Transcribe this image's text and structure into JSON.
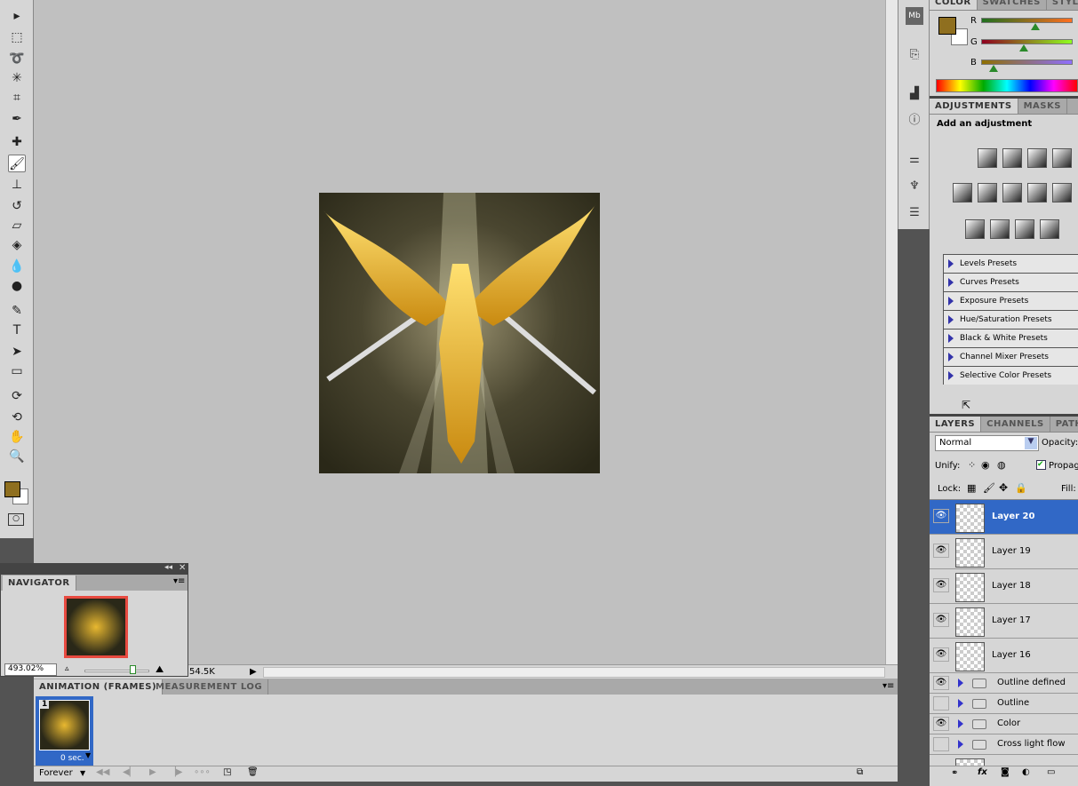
{
  "tools": [
    {
      "icon": "move-icon",
      "g": "▸"
    },
    {
      "icon": "marquee-icon",
      "g": "⬚"
    },
    {
      "icon": "lasso-icon",
      "g": "➰"
    },
    {
      "icon": "magic-wand-icon",
      "g": "✳"
    },
    {
      "icon": "crop-icon",
      "g": "⌗"
    },
    {
      "icon": "eyedropper-icon",
      "g": "✒"
    },
    {
      "icon": "healing-brush-icon",
      "g": "✚"
    },
    {
      "icon": "brush-icon",
      "g": "🖌"
    },
    {
      "icon": "clone-stamp-icon",
      "g": "⊥"
    },
    {
      "icon": "history-brush-icon",
      "g": "↺"
    },
    {
      "icon": "eraser-icon",
      "g": "▱"
    },
    {
      "icon": "paint-bucket-icon",
      "g": "◈"
    },
    {
      "icon": "blur-icon",
      "g": "💧"
    },
    {
      "icon": "dodge-icon",
      "g": "●"
    },
    {
      "icon": "pen-icon",
      "g": "✎"
    },
    {
      "icon": "type-icon",
      "g": "T"
    },
    {
      "icon": "path-selection-icon",
      "g": "➤"
    },
    {
      "icon": "rectangle-icon",
      "g": "▭"
    },
    {
      "icon": "3d-rotate-icon",
      "g": "⟳"
    },
    {
      "icon": "3d-orbit-icon",
      "g": "⟲"
    },
    {
      "icon": "hand-icon",
      "g": "✋"
    },
    {
      "icon": "zoom-icon",
      "g": "🔍"
    }
  ],
  "colors": {
    "foreground": "#8f6f1f",
    "background": "#ffffff",
    "accent": "#3168c6"
  },
  "color_panel": {
    "tabs": [
      "COLOR",
      "SWATCHES",
      "STYLES"
    ],
    "channels": [
      {
        "label": "R",
        "value": 143
      },
      {
        "label": "G",
        "value": 111
      },
      {
        "label": "B",
        "value": 31
      }
    ]
  },
  "adjustments": {
    "tabs": [
      "ADJUSTMENTS",
      "MASKS"
    ],
    "heading": "Add an adjustment",
    "presets": [
      "Levels Presets",
      "Curves Presets",
      "Exposure Presets",
      "Hue/Saturation Presets",
      "Black & White Presets",
      "Channel Mixer Presets",
      "Selective Color Presets"
    ]
  },
  "layers": {
    "tabs": [
      "LAYERS",
      "CHANNELS",
      "PATHS"
    ],
    "blend_mode": "Normal",
    "opacity_label": "Opacity:",
    "unify_label": "Unify:",
    "propagate_label": "Propag",
    "lock_label": "Lock:",
    "fill_label": "Fill:",
    "items": [
      {
        "name": "Layer 20",
        "visible": true,
        "selected": true
      },
      {
        "name": "Layer 19",
        "visible": true
      },
      {
        "name": "Layer 18",
        "visible": true
      },
      {
        "name": "Layer 17",
        "visible": true
      },
      {
        "name": "Layer 16",
        "visible": true
      }
    ],
    "groups": [
      {
        "name": "Outline defined",
        "visible": true
      },
      {
        "name": "Outline",
        "visible": false
      },
      {
        "name": "Color",
        "visible": true
      },
      {
        "name": "Cross light flow",
        "visible": false
      }
    ]
  },
  "navigator": {
    "title": "NAVIGATOR",
    "zoom": "493.02%",
    "zoom_slider": 0.75
  },
  "status": {
    "doc_size": "54.5K"
  },
  "animation": {
    "tabs": [
      "ANIMATION (FRAMES)",
      "MEASUREMENT LOG"
    ],
    "frame_number": "1",
    "frame_delay": "0 sec.",
    "loop": "Forever"
  }
}
